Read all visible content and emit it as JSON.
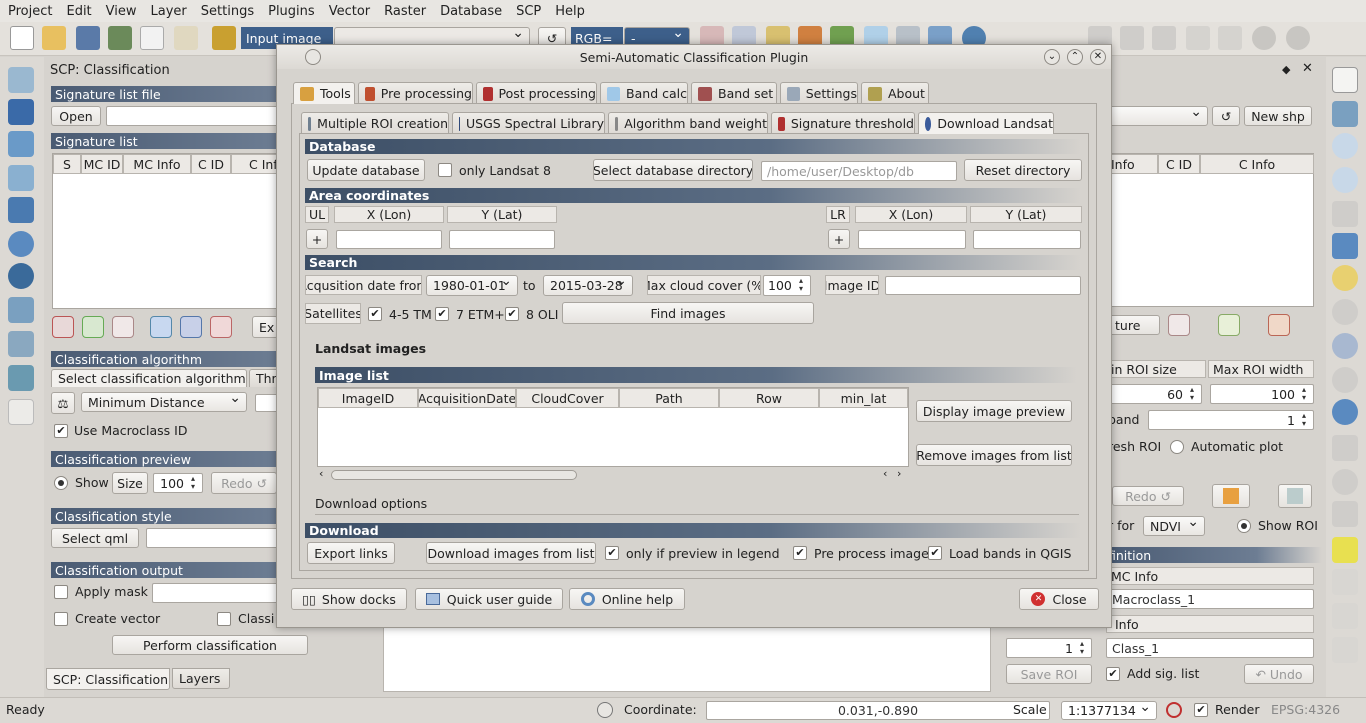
{
  "menu": [
    "Project",
    "Edit",
    "View",
    "Layer",
    "Settings",
    "Plugins",
    "Vector",
    "Raster",
    "Database",
    "SCP",
    "Help"
  ],
  "toolbar": {
    "input_image_label": "Input image",
    "rgb_label": "RGB=",
    "rgb_value": "-"
  },
  "left_dock": {
    "title": "SCP: Classification",
    "signature_list_file": "Signature list file",
    "open_button": "Open",
    "signature_list": "Signature list",
    "sig_columns": [
      "S",
      "MC ID",
      "MC Info",
      "C ID",
      "C Inf"
    ],
    "export_button": "Ex",
    "classification_algorithm": "Classification algorithm",
    "select_algorithm": "Select classification algorithm",
    "threshold_tab": "Thr",
    "algorithm_value": "Minimum Distance",
    "use_macroclass": "Use Macroclass ID",
    "classification_preview": "Classification preview",
    "show_label": "Show",
    "size_label": "Size",
    "size_value": "100",
    "redo_label": "Redo ↺",
    "classification_style": "Classification style",
    "select_qml": "Select qml",
    "classification_output": "Classification output",
    "apply_mask": "Apply mask",
    "create_vector": "Create vector",
    "classif_report": "Classi",
    "perform_classification": "Perform classification",
    "bottom_tabs": [
      "SCP: Classification",
      "Layers"
    ]
  },
  "right_dock": {
    "new_shp": "New shp",
    "columns": [
      "Info",
      "C ID",
      "C Info"
    ],
    "ture_label": "ture",
    "min_roi_size": "in ROI size",
    "max_roi_width": "Max ROI width",
    "min_roi_value": "60",
    "max_roi_value": "100",
    "band_label": "band",
    "band_value": "1",
    "resh_roi": "resh ROI",
    "automatic_plot": "Automatic  plot",
    "redo_label": "Redo ↺",
    "r_for": "r for",
    "ndvi_value": "NDVI",
    "show_roi": "Show ROI",
    "definition": "finition",
    "mc_info": "MC Info",
    "mc_info_value": "Macroclass_1",
    "c_info": "Info",
    "c_id_value": "1",
    "c_info_value": "Class_1",
    "save_roi": "Save ROI",
    "add_sig_list": "Add sig. list",
    "undo": "↶ Undo"
  },
  "dialog": {
    "title": "Semi-Automatic Classification Plugin",
    "main_tabs": [
      "Tools",
      "Pre processing",
      "Post processing",
      "Band calc",
      "Band set",
      "Settings",
      "About"
    ],
    "sub_tabs": [
      "Multiple ROI creation",
      "USGS Spectral Library",
      "Algorithm band weight",
      "Signature threshold",
      "Download Landsat"
    ],
    "database_section": "Database",
    "update_database": "Update database",
    "only_landsat8": "only Landsat 8",
    "select_db_dir": "Select database directory",
    "db_dir_placeholder": "/home/user/Desktop/db",
    "reset_directory": "Reset directory",
    "area_section": "Area coordinates",
    "ul": "UL",
    "lr": "LR",
    "x_lon": "X (Lon)",
    "y_lat": "Y (Lat)",
    "plus": "+",
    "search_section": "Search",
    "acq_from": "Acqusition date from",
    "date_from": "1980-01-01",
    "to": "to",
    "date_to": "2015-03-28",
    "max_cloud": "Max cloud cover (%)",
    "cloud_value": "100",
    "image_id": "Image ID",
    "satellites": "Satellites",
    "sat_45tm": "4-5 TM",
    "sat_7etm": "7 ETM+",
    "sat_8oli": "8 OLI",
    "find_images": "Find images",
    "landsat_images": "Landsat images",
    "image_list": "Image list",
    "image_columns": [
      "ImageID",
      "AcquisitionDate",
      "CloudCover",
      "Path",
      "Row",
      "min_lat"
    ],
    "display_preview": "Display image preview",
    "remove_images": "Remove images from list",
    "download_options": "Download options",
    "download_section": "Download",
    "export_links": "Export links",
    "download_images": "Download images from list",
    "only_preview": "only if preview in legend",
    "pre_process": "Pre process images",
    "load_bands": "Load bands in QGIS",
    "show_docks": "Show docks",
    "quick_guide": "Quick user guide",
    "online_help": "Online help",
    "close": "Close"
  },
  "status": {
    "ready": "Ready",
    "coordinate_label": "Coordinate:",
    "coordinate_value": "0.031,-0.890",
    "scale_label": "Scale",
    "scale_value": "1:1377134",
    "render": "Render",
    "epsg": "EPSG:4326"
  }
}
